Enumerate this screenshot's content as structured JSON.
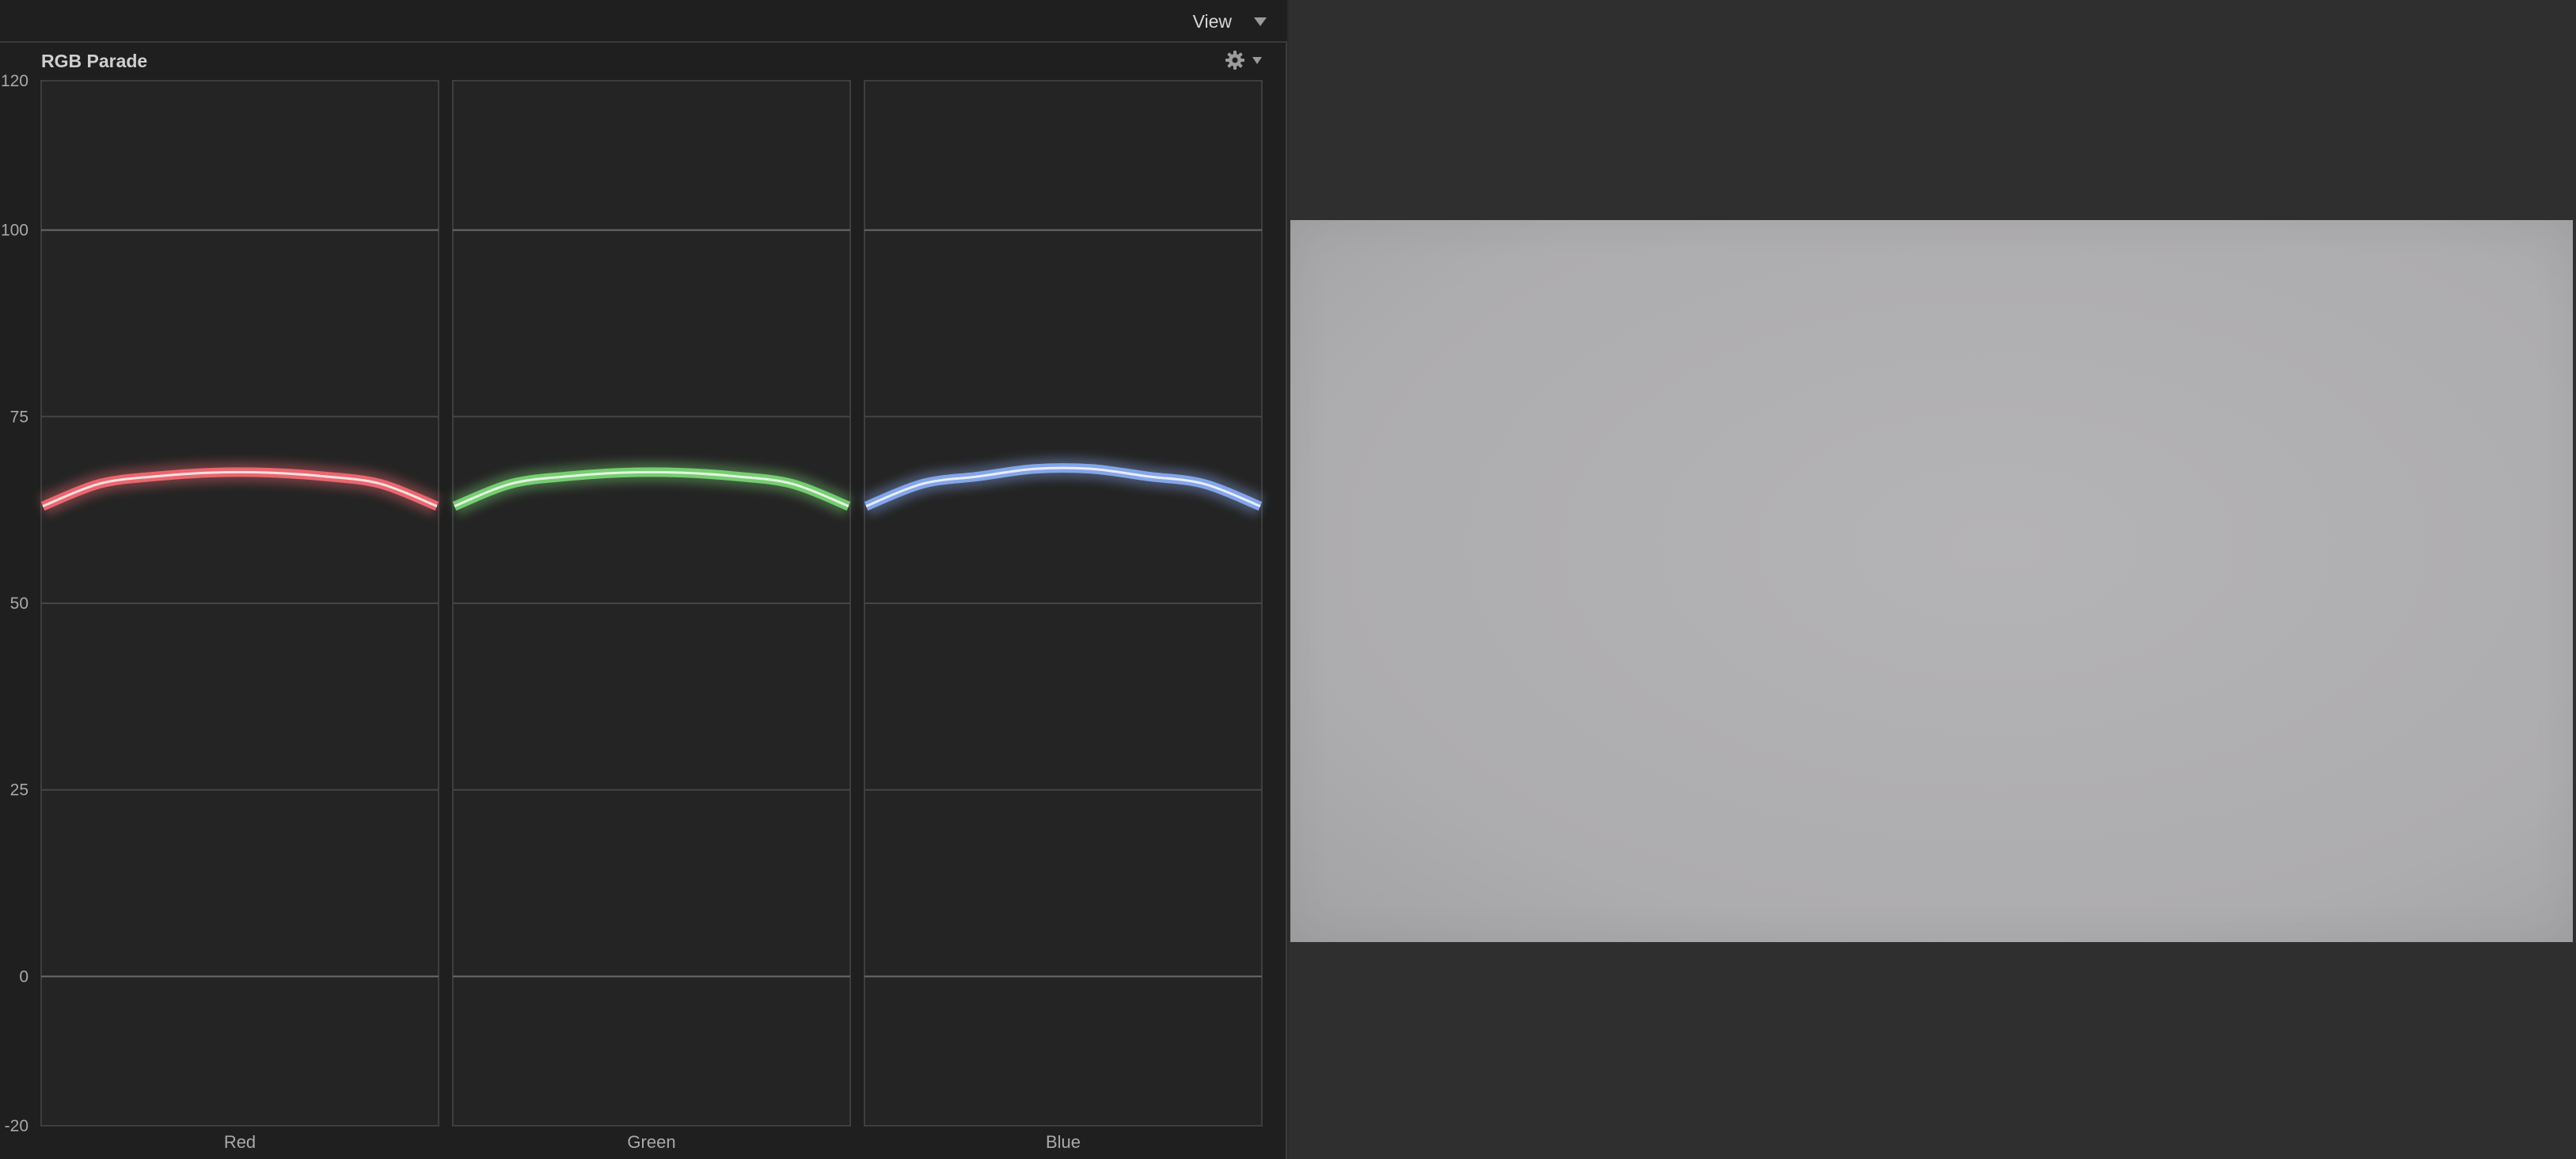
{
  "header": {
    "view_label": "View"
  },
  "scope": {
    "title": "RGB Parade",
    "icon": "gear-icon",
    "y_ticks": [
      "120",
      "100",
      "75",
      "50",
      "25",
      "0",
      "-20"
    ]
  },
  "chart_data": {
    "type": "line",
    "title": "RGB Parade",
    "ylim": [
      -20,
      120
    ],
    "y_ticks": [
      120,
      100,
      75,
      50,
      25,
      0,
      -20
    ],
    "grid": true,
    "series": [
      {
        "name": "Red",
        "color": "#ff6f78",
        "values": [
          63,
          66,
          67,
          67.5,
          67.5,
          67,
          66,
          63
        ]
      },
      {
        "name": "Green",
        "color": "#7fe07a",
        "values": [
          63,
          66,
          67,
          67.5,
          67.5,
          67,
          66,
          63
        ]
      },
      {
        "name": "Blue",
        "color": "#8fb4ff",
        "values": [
          63,
          66,
          67,
          68,
          68,
          67,
          66,
          63
        ]
      }
    ]
  },
  "viewer": {
    "frame_color": "#b0afb1"
  }
}
